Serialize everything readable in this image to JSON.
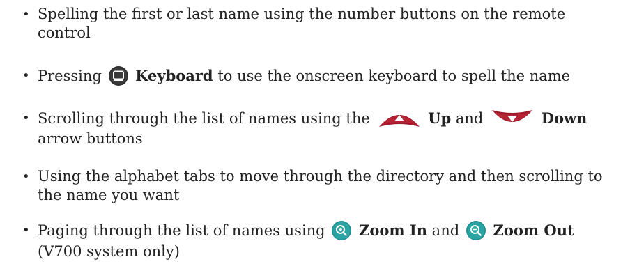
{
  "bullet": "•",
  "items": [
    {
      "text": "Spelling the first or last name using the number buttons on the remote control"
    },
    {
      "pre": "Pressing",
      "icon": "keyboard-button-icon",
      "key": "Keyboard",
      "post": "to use the onscreen keyboard to spell the name"
    },
    {
      "pre": "Scrolling through the list of names using the",
      "icon1": "up-arrow-button-icon",
      "key1": "Up",
      "mid": "and",
      "icon2": "down-arrow-button-icon",
      "key2": "Down",
      "post": "arrow buttons"
    },
    {
      "text": "Using the alphabet tabs to move through the directory and then scrolling to the name you want"
    },
    {
      "pre": "Paging through the list of names using",
      "icon1": "zoom-in-button-icon",
      "key1": "Zoom In",
      "mid": "and",
      "icon2": "zoom-out-button-icon",
      "key2": "Zoom Out",
      "post": "(V700 system only)"
    }
  ],
  "colors": {
    "text": "#222222",
    "arrow_button": "#9b1b2a",
    "keyboard_button": "#2b2b2b",
    "zoom_button": "#1e8f8f"
  }
}
